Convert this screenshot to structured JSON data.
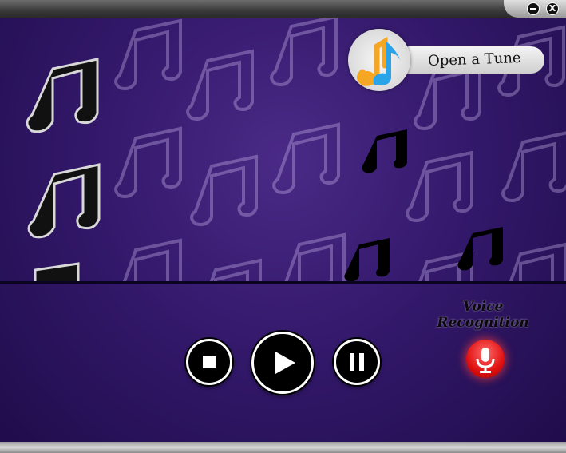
{
  "window": {
    "minimize_icon": "minimize-icon",
    "close_label": "X"
  },
  "open_tune": {
    "label": "Open a Tune",
    "logo_icon": "music-note-icon"
  },
  "controls": {
    "stop_icon": "stop-icon",
    "play_icon": "play-icon",
    "pause_icon": "pause-icon"
  },
  "voice": {
    "title_line1": "Voice",
    "title_line2": "Recognition",
    "mic_icon": "microphone-icon"
  },
  "colors": {
    "background": "#34196c",
    "accent_orange": "#f5a623",
    "accent_blue": "#2aa3e8",
    "mic_red": "#e01010"
  }
}
